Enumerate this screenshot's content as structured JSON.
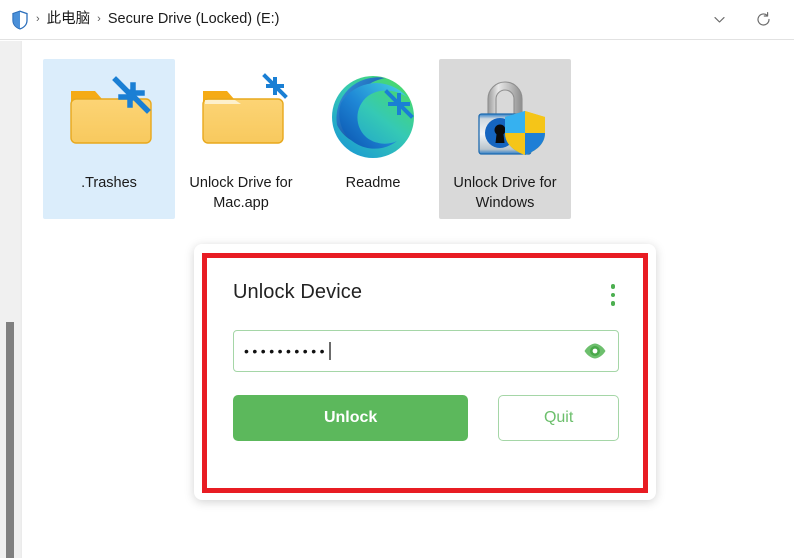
{
  "window": {
    "title": "Secure Drive (Locked) (E:)"
  },
  "addressbar": {
    "shield_icon": "shield-icon",
    "separator": "›",
    "crumbs": [
      {
        "label": "此电脑"
      },
      {
        "label": "Secure Drive (Locked) (E:)"
      }
    ],
    "history_dropdown_icon": "chevron-down-icon",
    "refresh_icon": "refresh-icon"
  },
  "files": [
    {
      "name": ".Trashes",
      "icon": "folder-compressed-icon",
      "selected": "active"
    },
    {
      "name": "Unlock Drive for Mac.app",
      "icon": "folder-compressed-icon",
      "selected": "none"
    },
    {
      "name": "Readme",
      "icon": "edge-browser-icon",
      "selected": "none"
    },
    {
      "name": "Unlock Drive for Windows",
      "icon": "padlock-windows-shield-icon",
      "selected": "inactive"
    }
  ],
  "dialog": {
    "title": "Unlock Device",
    "menu_icon": "kebab-menu-icon",
    "password": {
      "masked_value": "••••••••••",
      "char_count": 10,
      "placeholder": "",
      "reveal_icon": "eye-icon"
    },
    "unlock_label": "Unlock",
    "quit_label": "Quit",
    "highlight_color": "#e81c23",
    "accent_color": "#5cb85c",
    "outline_color": "#a5d6a7"
  },
  "scrollbar": {
    "orientation": "vertical",
    "thumb_name": "scrollbar-thumb"
  }
}
